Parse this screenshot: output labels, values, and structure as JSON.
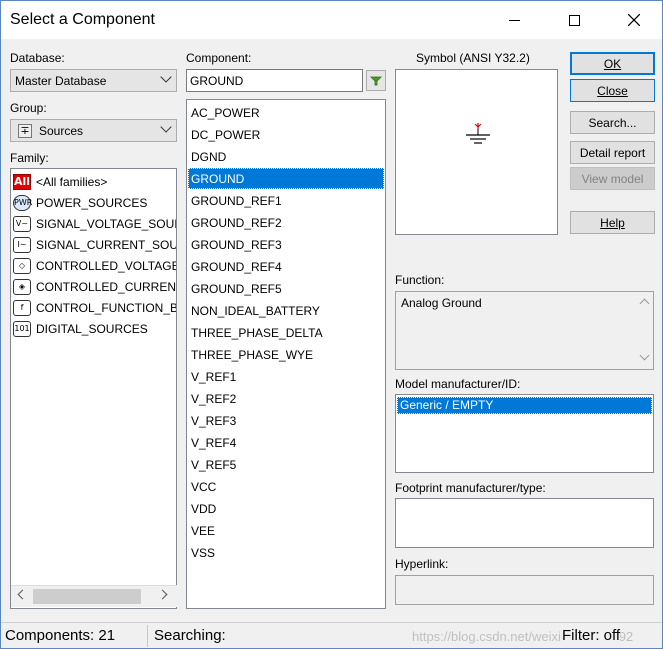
{
  "window": {
    "title": "Select a Component"
  },
  "database": {
    "label": "Database:",
    "value": "Master Database"
  },
  "group": {
    "label": "Group:",
    "value": "Sources",
    "icon": "sources-icon"
  },
  "family": {
    "label": "Family:",
    "items": [
      {
        "label": "<All families>",
        "icon": "all-families-icon",
        "selected": true
      },
      {
        "label": "POWER_SOURCES",
        "icon": "power-sources-icon",
        "selected": false
      },
      {
        "label": "SIGNAL_VOLTAGE_SOUI",
        "icon": "signal-voltage-icon",
        "selected": false
      },
      {
        "label": "SIGNAL_CURRENT_SOU",
        "icon": "signal-current-icon",
        "selected": false
      },
      {
        "label": "CONTROLLED_VOLTAGE",
        "icon": "controlled-voltage-icon",
        "selected": false
      },
      {
        "label": "CONTROLLED_CURRENT",
        "icon": "controlled-current-icon",
        "selected": false
      },
      {
        "label": "CONTROL_FUNCTION_B",
        "icon": "control-function-icon",
        "selected": false
      },
      {
        "label": "DIGITAL_SOURCES",
        "icon": "digital-sources-icon",
        "selected": false
      }
    ]
  },
  "component": {
    "label": "Component:",
    "search_value": "GROUND",
    "items": [
      "AC_POWER",
      "DC_POWER",
      "DGND",
      "GROUND",
      "GROUND_REF1",
      "GROUND_REF2",
      "GROUND_REF3",
      "GROUND_REF4",
      "GROUND_REF5",
      "NON_IDEAL_BATTERY",
      "THREE_PHASE_DELTA",
      "THREE_PHASE_WYE",
      "V_REF1",
      "V_REF2",
      "V_REF3",
      "V_REF4",
      "V_REF5",
      "VCC",
      "VDD",
      "VEE",
      "VSS"
    ],
    "selected_index": 3
  },
  "symbol": {
    "label": "Symbol (ANSI Y32.2)"
  },
  "buttons": {
    "ok": "OK",
    "close": "Close",
    "search": "Search...",
    "detail_report": "Detail report",
    "view_model": "View model",
    "help": "Help"
  },
  "function": {
    "label": "Function:",
    "value": "Analog Ground"
  },
  "model": {
    "label": "Model manufacturer/ID:",
    "items": [
      "Generic / EMPTY"
    ]
  },
  "footprint": {
    "label": "Footprint manufacturer/type:"
  },
  "hyperlink": {
    "label": "Hyperlink:"
  },
  "status": {
    "components": "Components: 21",
    "searching": "Searching:",
    "filter": "Filter: off",
    "watermark": "https://blog.csdn.net/weixin_44692092"
  },
  "colors": {
    "selection": "#0078d7",
    "symbol_red": "#d00000",
    "all_icon_red": "#e00000"
  }
}
